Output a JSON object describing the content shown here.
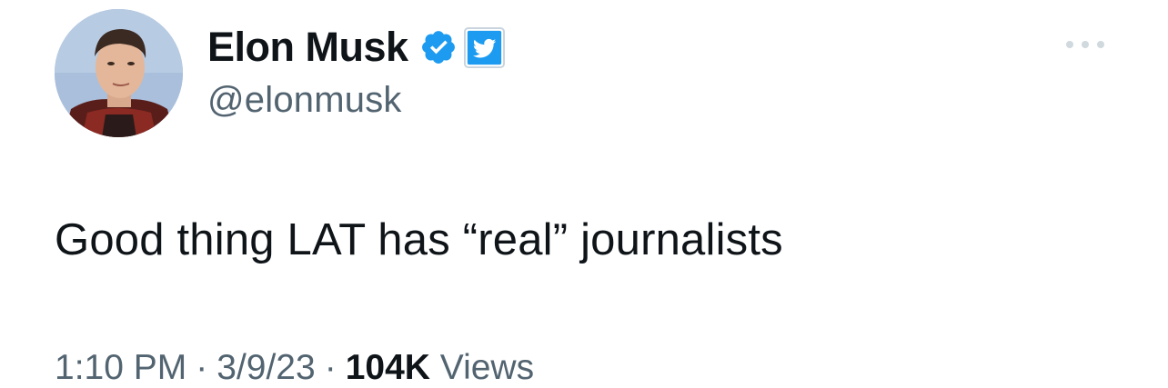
{
  "author": {
    "display_name": "Elon Musk",
    "handle": "@elonmusk",
    "avatar_icon": "profile-photo",
    "verified_icon": "verified-badge-icon",
    "affiliate_icon": "twitter-bird-icon"
  },
  "tweet": {
    "text": "Good thing LAT has “real” journalists"
  },
  "meta": {
    "time": "1:10 PM",
    "separator": "·",
    "date": "3/9/23",
    "views_count": "104K",
    "views_label": "Views"
  },
  "colors": {
    "verified_blue": "#1d9bf0",
    "secondary_text": "#536471",
    "primary_text": "#0f1419"
  },
  "icons": {
    "more": "more-options-icon"
  }
}
